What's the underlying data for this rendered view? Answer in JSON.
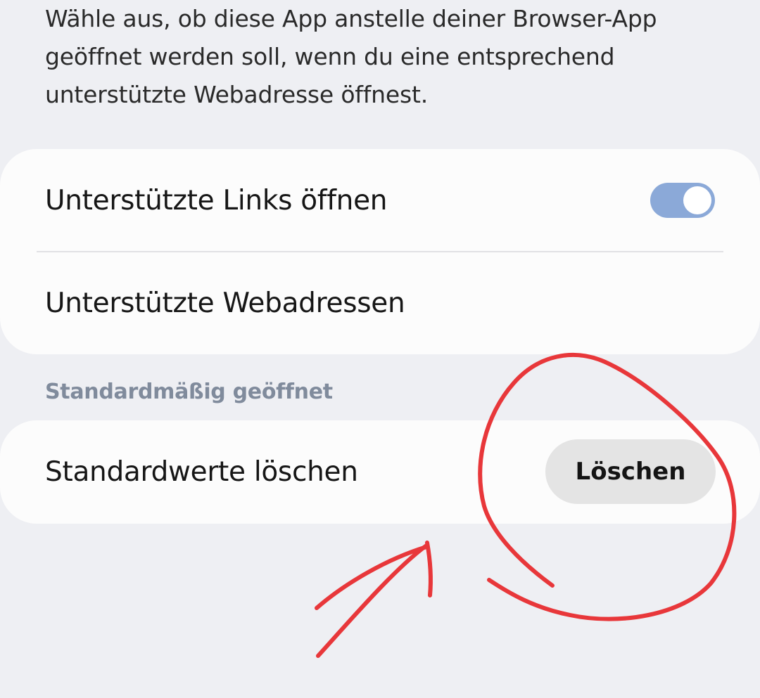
{
  "description": "Wähle aus, ob diese App anstelle deiner Browser-App geöffnet werden soll, wenn du eine entsprechend unterstützte Webadresse öffnest.",
  "links_card": {
    "open_supported_links_label": "Unterstützte Links öffnen",
    "open_supported_links_enabled": true,
    "supported_web_addresses_label": "Unterstützte Webadressen"
  },
  "default_section": {
    "header": "Standardmäßig geöffnet",
    "clear_defaults_label": "Standardwerte löschen",
    "clear_button_label": "Löschen"
  },
  "colors": {
    "background": "#eeeff3",
    "card": "#fcfcfc",
    "toggle_on": "#8ba9d8",
    "section_header": "#808b9c",
    "annotation_red": "#e8373a"
  }
}
